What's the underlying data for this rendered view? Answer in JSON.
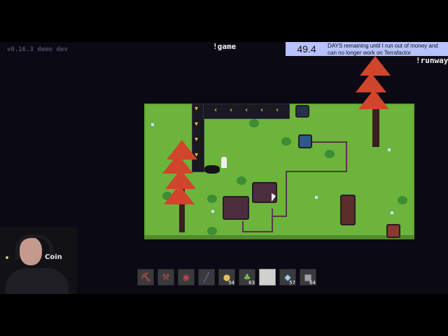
{
  "overlay": {
    "version": "v0.16.3 demo dev",
    "cmd_game": "!game",
    "cmd_runway": "!runway",
    "days_value": "49.4",
    "days_message": "DAYS remaining until I run out of money and can no longer work on Terrafactor"
  },
  "webcam": {
    "coin_label": "Coin"
  },
  "hotbar": {
    "slots": [
      {
        "icon": "pickaxe-icon",
        "count": ""
      },
      {
        "icon": "axe-icon",
        "count": ""
      },
      {
        "icon": "watering-can-icon",
        "count": ""
      },
      {
        "icon": "shovel-icon",
        "count": ""
      },
      {
        "icon": "seed-icon",
        "count": "54"
      },
      {
        "icon": "sapling-icon",
        "count": "63"
      },
      {
        "icon": "empty-slot",
        "count": ""
      },
      {
        "icon": "crystal-icon",
        "count": "57"
      },
      {
        "icon": "stone-icon",
        "count": "64"
      }
    ],
    "selected_index": 6
  },
  "colors": {
    "grass": "#6cb43c",
    "foliage": "#d0452c",
    "belt_arrow": "#e6b83a",
    "counter_bg": "#b8c2ff"
  }
}
